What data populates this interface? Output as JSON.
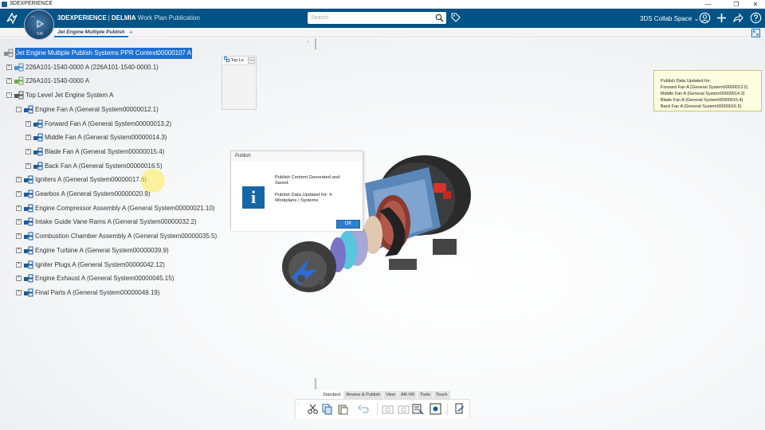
{
  "window": {
    "title": "3DEXPERIENCE",
    "controls": [
      "—",
      "❐",
      "✕"
    ]
  },
  "topbar": {
    "brand_bold": "3DEXPERIENCE",
    "brand_separator": "|",
    "brand_product": "DELMIA",
    "app_name": "Work Plan Publication",
    "search_placeholder": "Search",
    "collab_space": "3DS Collab Space",
    "accent_color": "#005386"
  },
  "compass": {
    "version": "V.R"
  },
  "tabs": {
    "active_label": "Jet Engine Multiple Publish",
    "add_label": "+"
  },
  "tree": {
    "collapse_label": "‹",
    "expand_symbol": "+",
    "collapse_symbol": "−",
    "rows": [
      {
        "label": "Jet Engine Multiple Publish Systems PPR Context00000107 A",
        "icon": "ppr-context-icon"
      },
      {
        "label": "226A101-1540-0000 A (226A101-1540-0000.1)",
        "icon": "product-icon"
      },
      {
        "label": "226A101-1540-0000 A",
        "icon": "resource-icon"
      },
      {
        "label": "Top Level Jet Engine System A",
        "icon": "system-icon"
      },
      {
        "label": "Engine Fan A (General System00000012.1)",
        "icon": "general-system-icon"
      },
      {
        "label": "Forward Fan A (General System00000013.2)",
        "icon": "general-system-icon"
      },
      {
        "label": "Middle Fan A (General System00000014.3)",
        "icon": "general-system-icon"
      },
      {
        "label": "Blade Fan A (General System00000015.4)",
        "icon": "general-system-icon"
      },
      {
        "label": "Back Fan A (General System00000016.5)",
        "icon": "general-system-icon"
      },
      {
        "label": "Igniters A (General System00000017.6)",
        "icon": "general-system-icon"
      },
      {
        "label": "Gearbox A (General System00000020.9)",
        "icon": "general-system-icon"
      },
      {
        "label": "Engine Compressor Assembly A (General System00000021.10)",
        "icon": "general-system-icon"
      },
      {
        "label": "Intake Guide Vane Rams A (General System00000032.2)",
        "icon": "general-system-icon"
      },
      {
        "label": "Combustion Chamber Assembly A (General System00000035.5)",
        "icon": "general-system-icon"
      },
      {
        "label": "Engine Turbine A (General System00000039.9)",
        "icon": "general-system-icon"
      },
      {
        "label": "Igniter Plugs A (General System00000042.12)",
        "icon": "general-system-icon"
      },
      {
        "label": "Engine Exhaust A (General System00000045.15)",
        "icon": "general-system-icon"
      },
      {
        "label": "Final Parts A (General System00000049.19)",
        "icon": "general-system-icon"
      }
    ]
  },
  "mini_window": {
    "title": "Top Le",
    "minimize": "—"
  },
  "note": {
    "lines": [
      "Publish Data Updated for:",
      "Forward Fan A (General System00000013.2)",
      "Middle Fan A (General System00000014.3)",
      "Blade Fan A (General System00000015.4)",
      "Back Fan A (General System00000016.5)"
    ]
  },
  "dialog": {
    "title": "Publish",
    "icon_glyph": "i",
    "message_line1": "Publish Content Generated and",
    "message_line2": "Saved.",
    "message_line3": "Publish Data Updated for:  4",
    "message_line4": "Workplans / Systems",
    "ok_label": "OK"
  },
  "action_bar": {
    "tabs": [
      "Standard",
      "Review & Publish",
      "View",
      "AR-VR",
      "Tools",
      "Touch"
    ],
    "active_tab": "Standard",
    "left_arrow": "‹",
    "right_arrow": "›"
  }
}
